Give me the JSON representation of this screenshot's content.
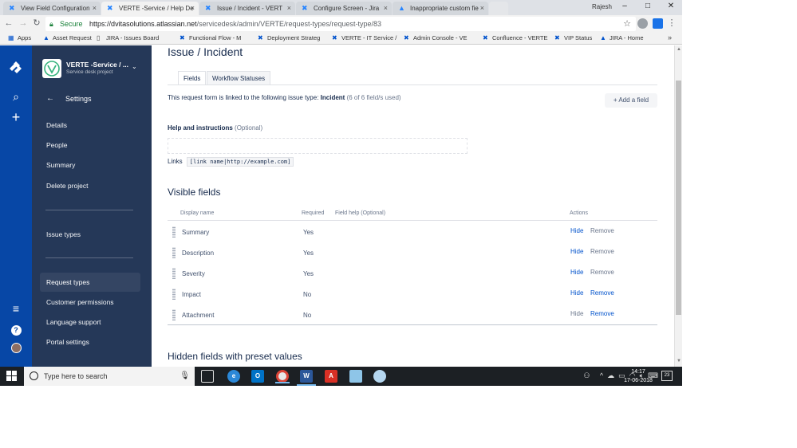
{
  "browser": {
    "tabs": [
      {
        "label": "View Field Configuration",
        "active": false
      },
      {
        "label": "VERTE -Service / Help De",
        "active": true
      },
      {
        "label": "Issue / Incident - VERT",
        "active": false
      },
      {
        "label": "Configure Screen - Jira",
        "active": false
      },
      {
        "label": "Inappropriate custom fie",
        "active": false
      }
    ],
    "window_user": "Rajesh",
    "secure_label": "Secure",
    "url_host": "https://dvitasolutions.atlassian.net",
    "url_path": "/servicedesk/admin/VERTE/request-types/request-type/83",
    "bookmarks": [
      "Apps",
      "Asset Request",
      "JIRA - Issues Board",
      "Functional Flow - M",
      "Deployment Strateg",
      "VERTE - IT Service /",
      "Admin Console - VE",
      "Confluence - VERTE",
      "VIP Status",
      "JIRA - Home"
    ]
  },
  "global_nav": {
    "icons": [
      "jira-logo-icon",
      "search-icon",
      "create-plus-icon",
      "menu-icon",
      "help-icon",
      "profile-avatar"
    ]
  },
  "sidebar": {
    "project_name": "VERTE -Service / ...",
    "project_type": "Service desk project",
    "settings_title": "Settings",
    "items": [
      {
        "label": "Details"
      },
      {
        "label": "People"
      },
      {
        "label": "Summary"
      },
      {
        "label": "Delete project"
      },
      {
        "label": "Issue types"
      },
      {
        "label": "Request types",
        "selected": true
      },
      {
        "label": "Customer permissions"
      },
      {
        "label": "Language support"
      },
      {
        "label": "Portal settings"
      }
    ]
  },
  "main": {
    "title": "Issue / Incident",
    "tabs": [
      {
        "label": "Fields",
        "active": true
      },
      {
        "label": "Workflow Statuses",
        "active": false
      }
    ],
    "form_description": {
      "prefix": "This request form is linked to the following issue type:",
      "issue_type": "Incident",
      "count": "(6 of 6 field/s used)"
    },
    "add_field_label": "Add a field",
    "help_heading": "Help and instructions",
    "help_optional": "(Optional)",
    "links_label": "Links",
    "links_example": "[link name|http://example.com]",
    "visible_fields_heading": "Visible fields",
    "columns": {
      "display_name": "Display name",
      "required": "Required",
      "field_help": "Field help (Optional)",
      "actions": "Actions"
    },
    "fields": [
      {
        "name": "Summary",
        "required": "Yes",
        "hide": "Hide",
        "remove": "Remove",
        "hide_enabled": true,
        "remove_enabled": false
      },
      {
        "name": "Description",
        "required": "Yes",
        "hide": "Hide",
        "remove": "Remove",
        "hide_enabled": true,
        "remove_enabled": false
      },
      {
        "name": "Severity",
        "required": "Yes",
        "hide": "Hide",
        "remove": "Remove",
        "hide_enabled": true,
        "remove_enabled": false
      },
      {
        "name": "Impact",
        "required": "No",
        "hide": "Hide",
        "remove": "Remove",
        "hide_enabled": true,
        "remove_enabled": true
      },
      {
        "name": "Attachment",
        "required": "No",
        "hide": "Hide",
        "remove": "Remove",
        "hide_enabled": false,
        "remove_enabled": true
      }
    ],
    "hidden_fields_heading": "Hidden fields with preset values"
  },
  "taskbar": {
    "search_placeholder": "Type here to search",
    "apps": [
      "task-view-icon",
      "edge-icon",
      "outlook-icon",
      "chrome-icon",
      "word-icon",
      "acrobat-icon",
      "notepad-icon",
      "paint-icon"
    ],
    "time": "14:17",
    "date": "17-06-2018",
    "notification_count": "23"
  },
  "colors": {
    "global_nav": "#0747a6",
    "project_nav": "#253858",
    "link": "#0052cc",
    "taskbar": "#1c2024"
  }
}
